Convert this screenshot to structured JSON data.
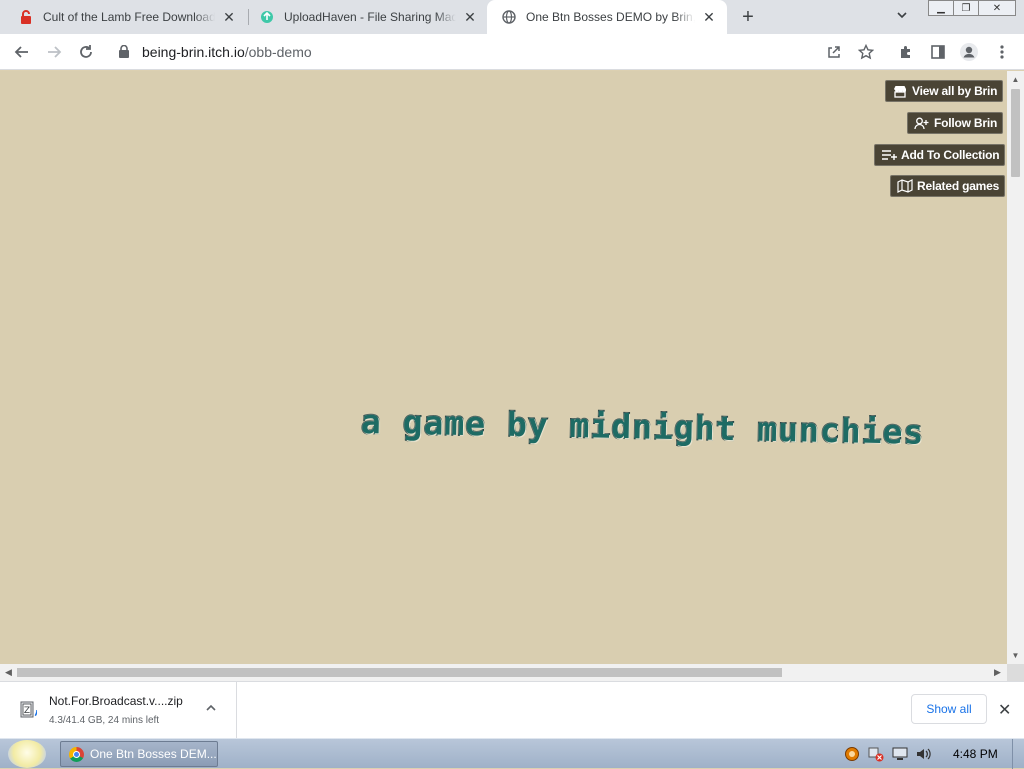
{
  "tabs": [
    {
      "title": "Cult of the Lamb Free Download",
      "favicon": "red-lock-favicon",
      "active": false
    },
    {
      "title": "UploadHaven - File Sharing Made",
      "favicon": "uploadhaven-favicon",
      "active": false
    },
    {
      "title": "One Btn Bosses DEMO by Brin, F",
      "favicon": "globe-icon",
      "active": true
    }
  ],
  "address_bar": {
    "host": "being-brin.itch.io",
    "path": "/obb-demo"
  },
  "itch_buttons": {
    "view_all": "View all by Brin",
    "follow": "Follow Brin",
    "add_collection": "Add To Collection",
    "related": "Related games"
  },
  "game": {
    "caption": "a game by midnight munchies"
  },
  "download": {
    "filename": "Not.For.Broadcast.v....zip",
    "status": "4.3/41.4 GB, 24 mins left",
    "show_all": "Show all"
  },
  "taskbar": {
    "task_label": "One Btn Bosses DEM...",
    "clock": "4:48 PM"
  },
  "colors": {
    "page_bg": "#d9ceb0",
    "itch_button_bg": "#4a4435",
    "game_text": "#1e6b64",
    "link_blue": "#1a73e8"
  }
}
